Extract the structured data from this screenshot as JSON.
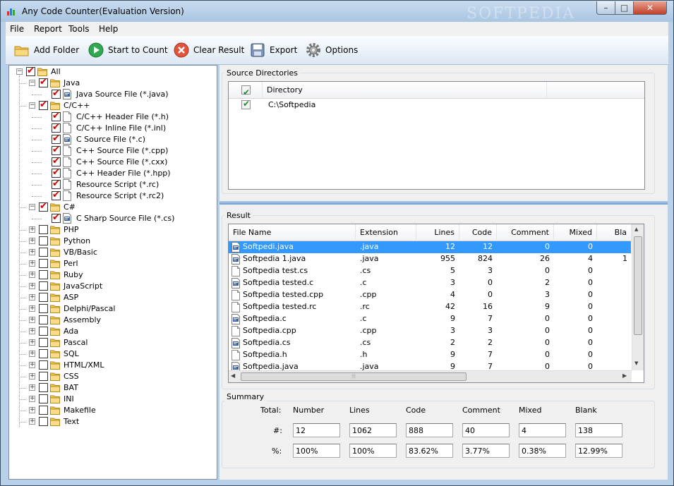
{
  "window": {
    "title": "Any Code Counter(Evaluation Version)",
    "watermark": "SOFTPEDIA",
    "minimize_glyph": "–",
    "maximize_glyph": "□",
    "close_glyph": "✕"
  },
  "menu": [
    "File",
    "Report",
    "Tools",
    "Help"
  ],
  "toolbar": {
    "add_folder": "Add Folder",
    "start_to_count": "Start to Count",
    "clear_result": "Clear Result",
    "export": "Export",
    "options": "Options"
  },
  "tree": [
    {
      "label": "All",
      "level": 0,
      "kind": "folder",
      "checked": true,
      "expander": "minus"
    },
    {
      "label": "Java",
      "level": 1,
      "kind": "folder",
      "checked": true,
      "expander": "minus"
    },
    {
      "label": "Java Source File (*.java)",
      "level": 2,
      "kind": "code-file",
      "checked": true
    },
    {
      "label": "C/C++",
      "level": 1,
      "kind": "folder",
      "checked": true,
      "expander": "minus"
    },
    {
      "label": "C/C++ Header File (*.h)",
      "level": 2,
      "kind": "file",
      "checked": true
    },
    {
      "label": "C/C++ Inline File (*.inl)",
      "level": 2,
      "kind": "file",
      "checked": true
    },
    {
      "label": "C Source File (*.c)",
      "level": 2,
      "kind": "code-file",
      "checked": true
    },
    {
      "label": "C++ Source File (*.cpp)",
      "level": 2,
      "kind": "file",
      "checked": true
    },
    {
      "label": "C++ Source File (*.cxx)",
      "level": 2,
      "kind": "file",
      "checked": true
    },
    {
      "label": "C++ Header File (*.hpp)",
      "level": 2,
      "kind": "file",
      "checked": true
    },
    {
      "label": "Resource Script (*.rc)",
      "level": 2,
      "kind": "file",
      "checked": true
    },
    {
      "label": "Resource Script (*.rc2)",
      "level": 2,
      "kind": "file",
      "checked": true
    },
    {
      "label": "C#",
      "level": 1,
      "kind": "folder",
      "checked": true,
      "expander": "minus"
    },
    {
      "label": "C Sharp Source File (*.cs)",
      "level": 2,
      "kind": "code-file",
      "checked": true
    },
    {
      "label": "PHP",
      "level": 1,
      "kind": "folder",
      "checked": false,
      "expander": "plus"
    },
    {
      "label": "Python",
      "level": 1,
      "kind": "folder",
      "checked": false,
      "expander": "plus"
    },
    {
      "label": "VB/Basic",
      "level": 1,
      "kind": "folder",
      "checked": false,
      "expander": "plus"
    },
    {
      "label": "Perl",
      "level": 1,
      "kind": "folder",
      "checked": false,
      "expander": "plus"
    },
    {
      "label": "Ruby",
      "level": 1,
      "kind": "folder",
      "checked": false,
      "expander": "plus"
    },
    {
      "label": "JavaScript",
      "level": 1,
      "kind": "folder",
      "checked": false,
      "expander": "plus"
    },
    {
      "label": "ASP",
      "level": 1,
      "kind": "folder",
      "checked": false,
      "expander": "plus"
    },
    {
      "label": "Delphi/Pascal",
      "level": 1,
      "kind": "folder",
      "checked": false,
      "expander": "plus"
    },
    {
      "label": "Assembly",
      "level": 1,
      "kind": "folder",
      "checked": false,
      "expander": "plus"
    },
    {
      "label": "Ada",
      "level": 1,
      "kind": "folder",
      "checked": false,
      "expander": "plus"
    },
    {
      "label": "Pascal",
      "level": 1,
      "kind": "folder",
      "checked": false,
      "expander": "plus"
    },
    {
      "label": "SQL",
      "level": 1,
      "kind": "folder",
      "checked": false,
      "expander": "plus"
    },
    {
      "label": "HTML/XML",
      "level": 1,
      "kind": "folder",
      "checked": false,
      "expander": "plus"
    },
    {
      "label": "CSS",
      "level": 1,
      "kind": "folder",
      "checked": false,
      "expander": "plus"
    },
    {
      "label": "BAT",
      "level": 1,
      "kind": "folder",
      "checked": false,
      "expander": "plus"
    },
    {
      "label": "INI",
      "level": 1,
      "kind": "folder",
      "checked": false,
      "expander": "plus"
    },
    {
      "label": "Makefile",
      "level": 1,
      "kind": "folder",
      "checked": false,
      "expander": "plus"
    },
    {
      "label": "Text",
      "level": 1,
      "kind": "folder",
      "checked": false,
      "expander": "plus"
    }
  ],
  "source_directories": {
    "group_label": "Source Directories",
    "column_header": "Directory",
    "rows": [
      {
        "checked": true,
        "path": "C:\\Softpedia"
      }
    ]
  },
  "result": {
    "group_label": "Result",
    "columns": [
      "File Name",
      "Extension",
      "Lines",
      "Code",
      "Comment",
      "Mixed",
      "Bla"
    ],
    "rows": [
      {
        "name": "Softpedi.java",
        "ext": ".java",
        "lines": "12",
        "code": "12",
        "comment": "0",
        "mixed": "0",
        "blank": "",
        "icon": "code-file",
        "selected": true
      },
      {
        "name": "Softpedia 1.java",
        "ext": ".java",
        "lines": "955",
        "code": "824",
        "comment": "26",
        "mixed": "4",
        "blank": "1",
        "icon": "code-file"
      },
      {
        "name": "Softpedia test.cs",
        "ext": ".cs",
        "lines": "5",
        "code": "3",
        "comment": "0",
        "mixed": "0",
        "blank": "",
        "icon": "file"
      },
      {
        "name": "Softpedia tested.c",
        "ext": ".c",
        "lines": "3",
        "code": "0",
        "comment": "2",
        "mixed": "0",
        "blank": "",
        "icon": "code-file"
      },
      {
        "name": "Softpedia tested.cpp",
        "ext": ".cpp",
        "lines": "4",
        "code": "0",
        "comment": "3",
        "mixed": "0",
        "blank": "",
        "icon": "file"
      },
      {
        "name": "Softpedia tested.rc",
        "ext": ".rc",
        "lines": "42",
        "code": "16",
        "comment": "9",
        "mixed": "0",
        "blank": "",
        "icon": "file"
      },
      {
        "name": "Softpedia.c",
        "ext": ".c",
        "lines": "9",
        "code": "7",
        "comment": "0",
        "mixed": "0",
        "blank": "",
        "icon": "code-file"
      },
      {
        "name": "Softpedia.cpp",
        "ext": ".cpp",
        "lines": "3",
        "code": "3",
        "comment": "0",
        "mixed": "0",
        "blank": "",
        "icon": "file"
      },
      {
        "name": "Softpedia.cs",
        "ext": ".cs",
        "lines": "2",
        "code": "2",
        "comment": "0",
        "mixed": "0",
        "blank": "",
        "icon": "code-file"
      },
      {
        "name": "Softpedia.h",
        "ext": ".h",
        "lines": "9",
        "code": "7",
        "comment": "0",
        "mixed": "0",
        "blank": "",
        "icon": "file"
      },
      {
        "name": "Softpedia.java",
        "ext": ".java",
        "lines": "9",
        "code": "7",
        "comment": "0",
        "mixed": "0",
        "blank": "",
        "icon": "code-file"
      }
    ],
    "hscroll_grip": "⦙⦙⦙"
  },
  "summary": {
    "group_label": "Summary",
    "total_label": "Total:",
    "count_label": "#:",
    "percent_label": "%:",
    "columns": [
      "Number",
      "Lines",
      "Code",
      "Comment",
      "Mixed",
      "Blank"
    ],
    "counts": [
      "12",
      "1062",
      "888",
      "40",
      "4",
      "138"
    ],
    "percents": [
      "100%",
      "100%",
      "83.62%",
      "3.77%",
      "0.38%",
      "12.99%"
    ]
  }
}
